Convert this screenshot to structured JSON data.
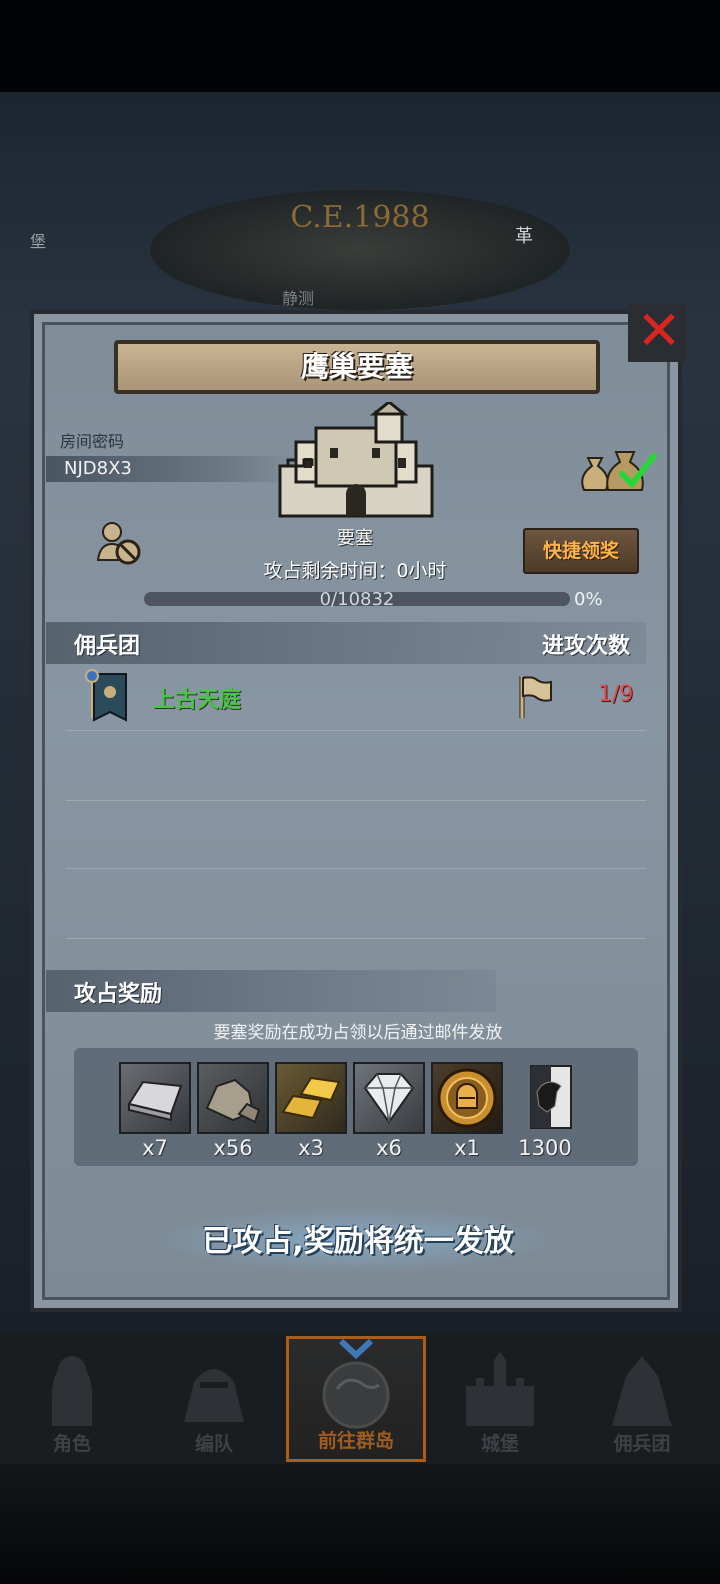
{
  "background": {
    "era_title": "C.E.1988",
    "left_label": "堡",
    "right_label": "革",
    "center_label": "静测",
    "colors": {
      "era_gold": "#8a6a36"
    }
  },
  "dialog": {
    "title": "鹰巢要塞",
    "close_icon": "close-x-icon",
    "room": {
      "label": "房间密码",
      "code": "NJD8X3"
    },
    "fortress": {
      "label": "要塞",
      "icon": "castle-icon"
    },
    "quick_claim_label": "快捷领奖",
    "occupy_time": "攻占剩余时间：0小时",
    "progress": {
      "text": "0/10832",
      "current": 0,
      "max": 10832,
      "percent_text": "0%",
      "fraction": 0.0
    },
    "mercenary_header": "佣兵团",
    "attack_count_header": "进攻次数",
    "rows": [
      {
        "name": "上古天庭",
        "count": "1/9",
        "name_color": "#4ec24a",
        "count_color": "#e34b4b"
      }
    ],
    "rewards": {
      "header": "攻占奖励",
      "note": "要塞奖励在成功占领以后通过邮件发放",
      "items": [
        {
          "icon": "silver-ingot-icon",
          "qty": "x7"
        },
        {
          "icon": "stone-ore-icon",
          "qty": "x56"
        },
        {
          "icon": "gold-bars-icon",
          "qty": "x3"
        },
        {
          "icon": "diamond-icon",
          "qty": "x6"
        },
        {
          "icon": "knight-medal-icon",
          "qty": "x1"
        },
        {
          "icon": "bull-banner-icon",
          "qty": "1300"
        }
      ]
    },
    "final_message": "已攻占,奖励将统一发放"
  },
  "nav": {
    "items": [
      {
        "label": "角色",
        "icon": "knight-icon"
      },
      {
        "label": "编队",
        "icon": "helmet-icon"
      },
      {
        "label": "前往群岛",
        "icon": "globe-icon"
      },
      {
        "label": "城堡",
        "icon": "castle-silhouette-icon"
      },
      {
        "label": "佣兵团",
        "icon": "mercenary-icon"
      }
    ],
    "active_index": 2
  }
}
